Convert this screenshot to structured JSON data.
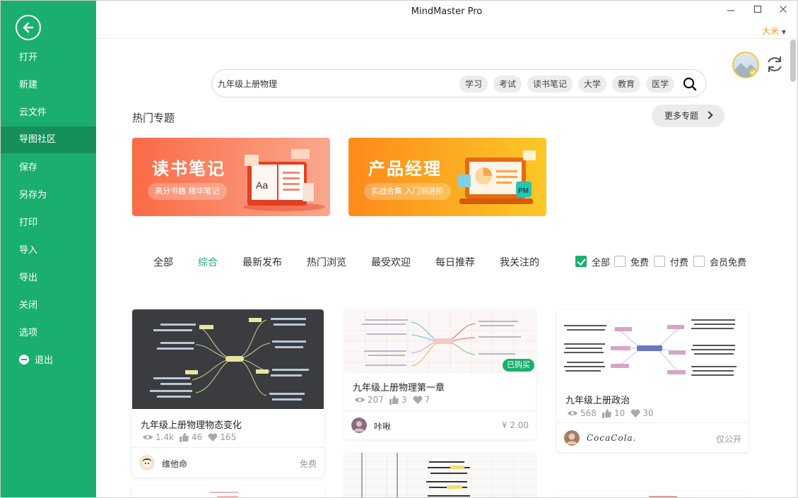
{
  "window": {
    "title": "MindMaster Pro",
    "user": "大米"
  },
  "sidebar": {
    "items": [
      {
        "label": "打开"
      },
      {
        "label": "新建"
      },
      {
        "label": "云文件"
      },
      {
        "label": "导图社区"
      },
      {
        "label": "保存"
      },
      {
        "label": "另存为"
      },
      {
        "label": "打印"
      },
      {
        "label": "导入"
      },
      {
        "label": "导出"
      },
      {
        "label": "关闭"
      },
      {
        "label": "选项"
      },
      {
        "label": "退出"
      }
    ],
    "active": "导图社区"
  },
  "search": {
    "value": "九年级上册物理",
    "tags": [
      "学习",
      "考试",
      "读书笔记",
      "大学",
      "教育",
      "医学"
    ]
  },
  "featured": {
    "title": "热门专题",
    "more_label": "更多专题",
    "banners": [
      {
        "title": "读书笔记",
        "subtitle": "高分书籍 精华笔记",
        "art_text": "Aa"
      },
      {
        "title": "产品经理",
        "subtitle": "实战合集 入门到进阶",
        "art_text": "PM"
      }
    ]
  },
  "filters": {
    "tabs": [
      "全部",
      "综合",
      "最新发布",
      "热门浏览",
      "最受欢迎",
      "每日推荐",
      "我关注的"
    ],
    "active_tab": "综合",
    "checkboxes": [
      {
        "label": "全部",
        "checked": true
      },
      {
        "label": "免费",
        "checked": false
      },
      {
        "label": "付费",
        "checked": false
      },
      {
        "label": "会员免费",
        "checked": false
      }
    ]
  },
  "cards": [
    {
      "title": "九年级上册物理物态变化",
      "views": "1.4k",
      "likes": "46",
      "favorites": "165",
      "author": "维他命",
      "price": "免费",
      "theme": "dark"
    },
    {
      "title": "九年级上册物理第一章",
      "views": "207",
      "likes": "3",
      "favorites": "7",
      "author": "咔啾",
      "price": "¥ 2.00",
      "badge": "已购买",
      "theme": "grid"
    },
    {
      "title": "九年级上册政治",
      "views": "568",
      "likes": "10",
      "favorites": "30",
      "author": "CocaCola.",
      "price": "仅公开",
      "theme": "light"
    }
  ],
  "colors": {
    "brand": "#1aaf6f",
    "brand_dark": "#16905b",
    "accent": "#f29b1d"
  }
}
